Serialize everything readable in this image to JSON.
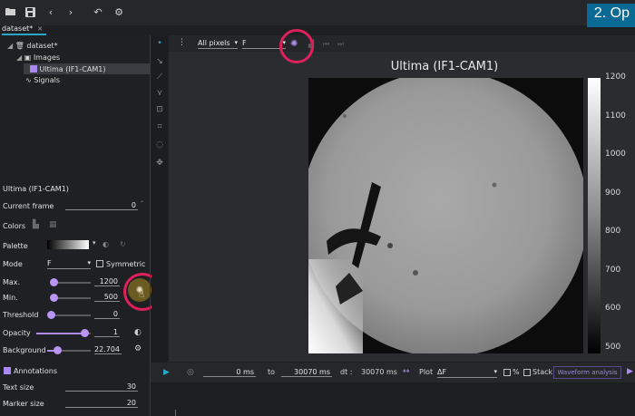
{
  "toolbar": {
    "icons": [
      "folder-open-icon",
      "save-icon",
      "back-icon",
      "forward-icon",
      "undo-icon",
      "settings-icon"
    ]
  },
  "banner": {
    "text": "2. Op"
  },
  "tab": {
    "label": "dataset*"
  },
  "tree": {
    "dataset": "dataset*",
    "images": "Images",
    "image_item": "Ultima (IF1-CAM1)",
    "signals": "Signals"
  },
  "properties": {
    "title": "Ultima (IF1-CAM1)",
    "current_frame_label": "Current frame",
    "current_frame": "0",
    "colors_label": "Colors",
    "palette_label": "Palette",
    "mode_label": "Mode",
    "mode_value": "F",
    "symmetric_label": "Symmetric",
    "max_label": "Max.",
    "max_value": "1200",
    "min_label": "Min.",
    "min_value": "500",
    "threshold_label": "Threshold",
    "threshold_value": "0",
    "opacity_label": "Opacity",
    "opacity_value": "1",
    "background_label": "Background",
    "background_value": "22.704",
    "annotations_label": "Annotations",
    "text_size_label": "Text size",
    "text_size_value": "30",
    "marker_size_label": "Marker size",
    "marker_size_value": "20",
    "sliders": {
      "max": 0.07,
      "min": 0.06,
      "threshold": 0.0,
      "opacity": 0.88,
      "background": 0.22
    }
  },
  "viewer": {
    "pixels_select": "All pixels",
    "signal_select": "F",
    "image_title": "Ultima (IF1-CAM1)",
    "colorbar_ticks": [
      "1200",
      "1100",
      "1000",
      "900",
      "800",
      "700",
      "600",
      "500"
    ]
  },
  "bottom": {
    "start_time": "0 ms",
    "to_label": "to",
    "end_time": "30070 ms",
    "dt_label": "dt :",
    "dt_value": "30070 ms",
    "plot_label": "Plot",
    "plot_value": "ΔF",
    "percent_label": "%",
    "stack_label": "Stack",
    "waveform_button": "Waveform analysis"
  },
  "colors": {
    "accent": "#b18cf0",
    "highlight_ring": "#e0205c",
    "banner": "#0a6a93"
  }
}
